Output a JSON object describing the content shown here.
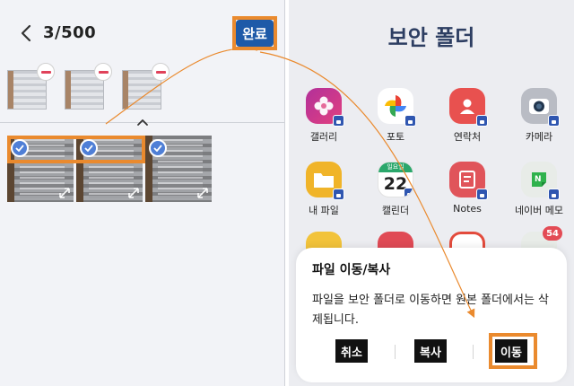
{
  "left": {
    "counter": "3/500",
    "done_label": "완료",
    "selected_thumbs": [
      "photo-1",
      "photo-2",
      "photo-3"
    ],
    "grid_items": [
      "photo-1",
      "photo-2",
      "photo-3"
    ]
  },
  "right": {
    "title": "보안 폴더",
    "apps": [
      {
        "label": "갤러리",
        "icon": "gallery-icon"
      },
      {
        "label": "포토",
        "icon": "photos-icon"
      },
      {
        "label": "연락처",
        "icon": "contacts-icon"
      },
      {
        "label": "카메라",
        "icon": "camera-icon"
      },
      {
        "label": "내 파일",
        "icon": "my-files-icon"
      },
      {
        "label": "캘린더",
        "icon": "calendar-icon",
        "day_label": "일요일",
        "day": "22"
      },
      {
        "label": "Notes",
        "icon": "notes-icon"
      },
      {
        "label": "네이버 메모",
        "icon": "naver-memo-icon"
      }
    ],
    "partial_badge": "54"
  },
  "dialog": {
    "title": "파일 이동/복사",
    "message": "파일을 보안 폴더로 이동하면 원본 폴더에서는 삭제됩니다.",
    "cancel_label": "취소",
    "copy_label": "복사",
    "move_label": "이동"
  },
  "colors": {
    "accent_highlight": "#ea8a2e",
    "primary_blue": "#1e5aa8",
    "title_navy": "#2d3e62",
    "remove_red": "#e0425a"
  }
}
